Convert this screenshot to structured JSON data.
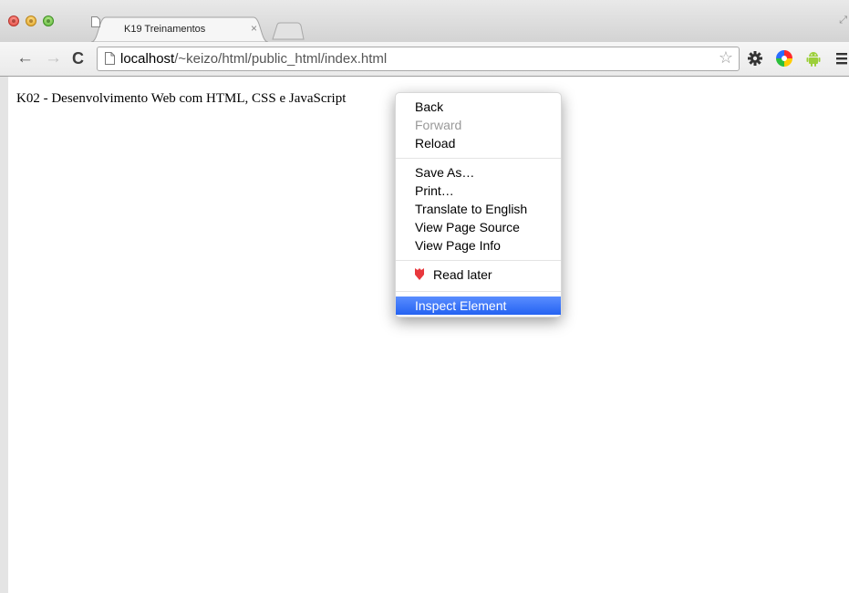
{
  "browser": {
    "tab": {
      "title": "K19 Treinamentos",
      "close": "×"
    },
    "nav": {
      "back": "←",
      "forward": "→",
      "reload": "C"
    },
    "address": {
      "host": "localhost",
      "path": "/~keizo/html/public_html/index.html"
    },
    "bookmark": "☆",
    "extensions": [
      "gear-icon",
      "color-wheel-icon",
      "android-icon",
      "menu-icon"
    ]
  },
  "page": {
    "heading": "K02 - Desenvolvimento Web com HTML, CSS e JavaScript"
  },
  "context_menu": {
    "groups": [
      [
        {
          "label": "Back"
        },
        {
          "label": "Forward",
          "disabled": true
        },
        {
          "label": "Reload"
        }
      ],
      [
        {
          "label": "Save As…"
        },
        {
          "label": "Print…"
        },
        {
          "label": "Translate to English"
        },
        {
          "label": "View Page Source"
        },
        {
          "label": "View Page Info"
        }
      ],
      [
        {
          "label": "Read later",
          "icon": "pocket-icon"
        }
      ],
      [
        {
          "label": "Inspect Element",
          "selected": true
        }
      ]
    ]
  },
  "colors": {
    "selection": "#2f6ef5",
    "toolbar": "#ececec"
  }
}
